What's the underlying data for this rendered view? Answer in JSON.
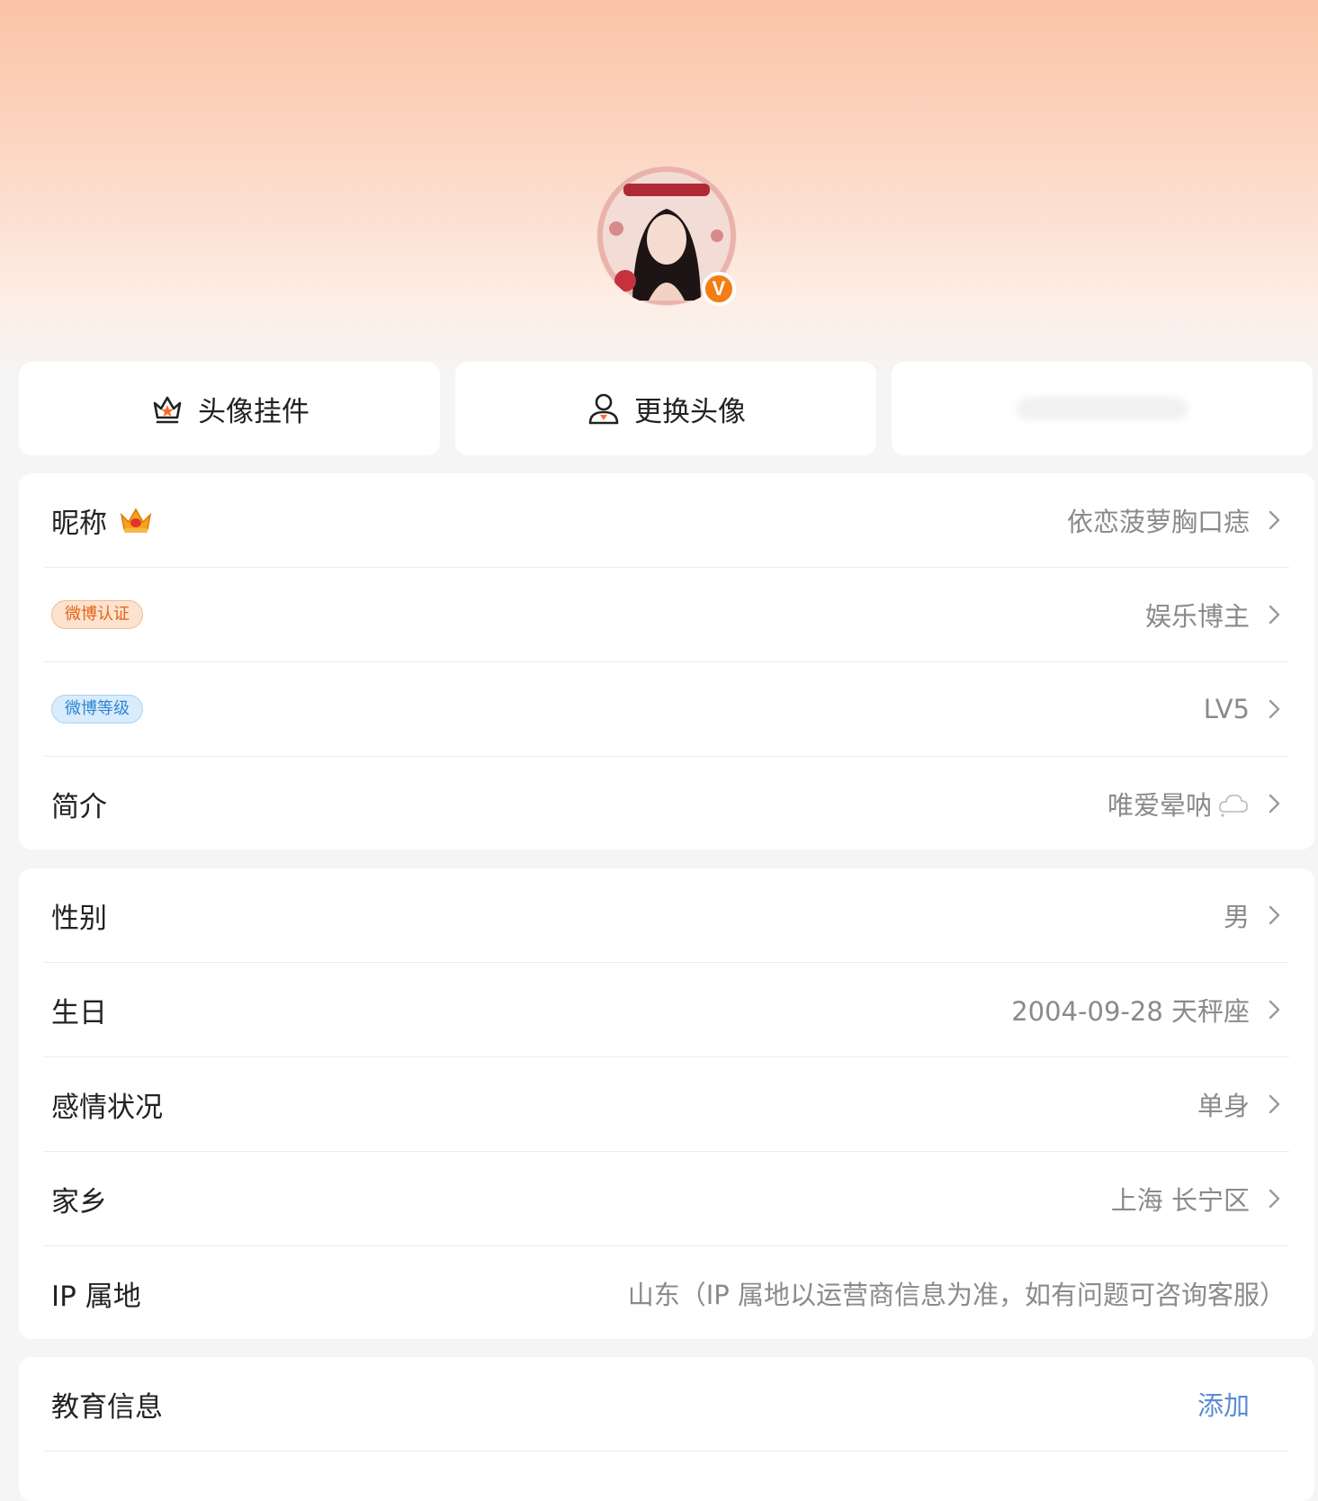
{
  "colors": {
    "header_gradient_top": "#fbc3a6",
    "badge_orange": "#f47d14",
    "link_blue": "#5b8bd6",
    "value_gray": "#8a8a8a"
  },
  "avatar": {
    "verified_badge": "V"
  },
  "actions": {
    "pendant_label": "头像挂件",
    "pendant_icon": "crown-badge-icon",
    "change_avatar_label": "更换头像",
    "change_avatar_icon": "person-icon"
  },
  "profile": {
    "nickname": {
      "label": "昵称",
      "value": "依恋菠萝胸口痣"
    },
    "verification": {
      "tag": "微博认证",
      "value": "娱乐博主"
    },
    "level": {
      "tag": "微博等级",
      "value": "LV5"
    },
    "bio": {
      "label": "简介",
      "value": "唯爱晕呐"
    }
  },
  "personal": {
    "gender": {
      "label": "性别",
      "value": "男"
    },
    "birthday": {
      "label": "生日",
      "value": "2004-09-28 天秤座"
    },
    "relationship": {
      "label": "感情状况",
      "value": "单身"
    },
    "hometown": {
      "label": "家乡",
      "value": "上海 长宁区"
    },
    "ip": {
      "label": "IP 属地",
      "value": "山东（IP 属地以运营商信息为准，如有问题可咨询客服）"
    }
  },
  "education": {
    "label": "教育信息",
    "action": "添加"
  }
}
